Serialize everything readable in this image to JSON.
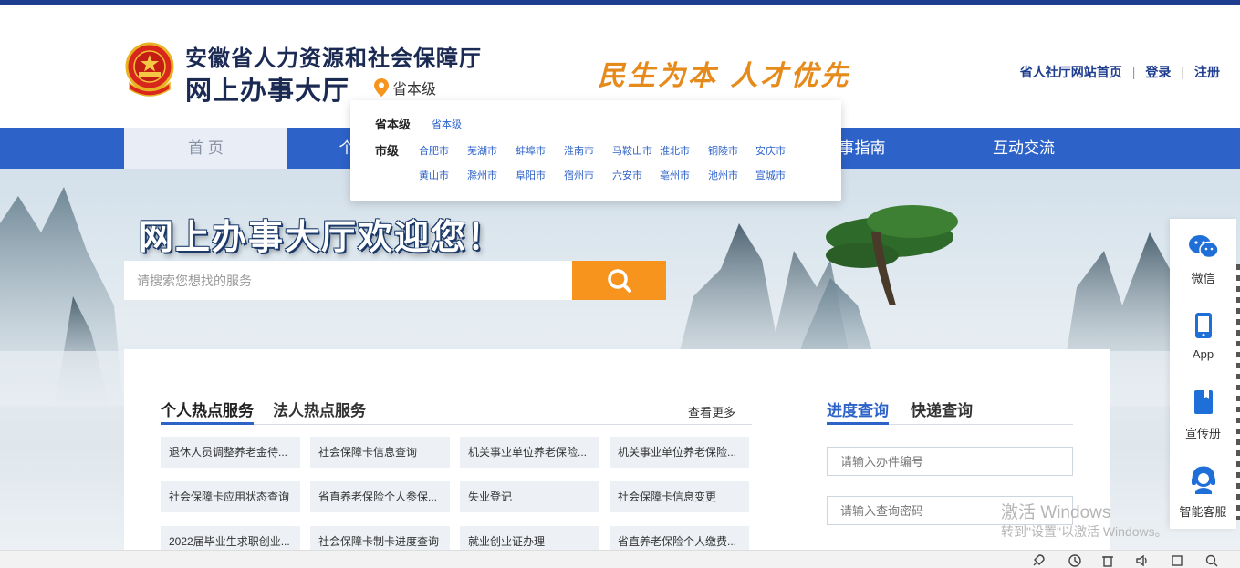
{
  "header": {
    "org_name": "安徽省人力资源和社会保障厅",
    "hall_name": "网上办事大厅",
    "location": "省本级",
    "slogan": "民生为本 人才优先",
    "links": {
      "home": "省人社厅网站首页",
      "login": "登录",
      "register": "注册"
    }
  },
  "nav": {
    "items": [
      "首 页",
      "个",
      "事指南",
      "互动交流"
    ]
  },
  "dropdown": {
    "province_label": "省本级",
    "province_value": "省本级",
    "city_label": "市级",
    "cities_row1": [
      "合肥市",
      "芜湖市",
      "蚌埠市",
      "淮南市",
      "马鞍山市",
      "淮北市",
      "铜陵市",
      "安庆市"
    ],
    "cities_row2": [
      "黄山市",
      "滁州市",
      "阜阳市",
      "宿州市",
      "六安市",
      "亳州市",
      "池州市",
      "宣城市"
    ]
  },
  "banner": {
    "welcome": "网上办事大厅欢迎您！",
    "search_placeholder": "请搜索您想找的服务"
  },
  "hot_services": {
    "tabs": [
      "个人热点服务",
      "法人热点服务"
    ],
    "more": "查看更多",
    "items": [
      "退休人员调整养老金待...",
      "社会保障卡信息查询",
      "机关事业单位养老保险...",
      "机关事业单位养老保险...",
      "社会保障卡应用状态查询",
      "省直养老保险个人参保...",
      "失业登记",
      "社会保障卡信息变更",
      "2022届毕业生求职创业...",
      "社会保障卡制卡进度查询",
      "就业创业证办理",
      "省直养老保险个人缴费..."
    ]
  },
  "query": {
    "tabs": [
      "进度查询",
      "快递查询"
    ],
    "case_placeholder": "请输入办件编号",
    "code_placeholder": "请输入查询密码"
  },
  "side": {
    "items": [
      "微信",
      "App",
      "宣传册",
      "智能客服"
    ]
  },
  "watermark": {
    "title": "激活 Windows",
    "sub": "转到\"设置\"以激活 Windows。"
  },
  "colors": {
    "brand_blue": "#2d62c9",
    "accent_orange": "#f7941d",
    "dark_blue": "#1f3d8f"
  }
}
